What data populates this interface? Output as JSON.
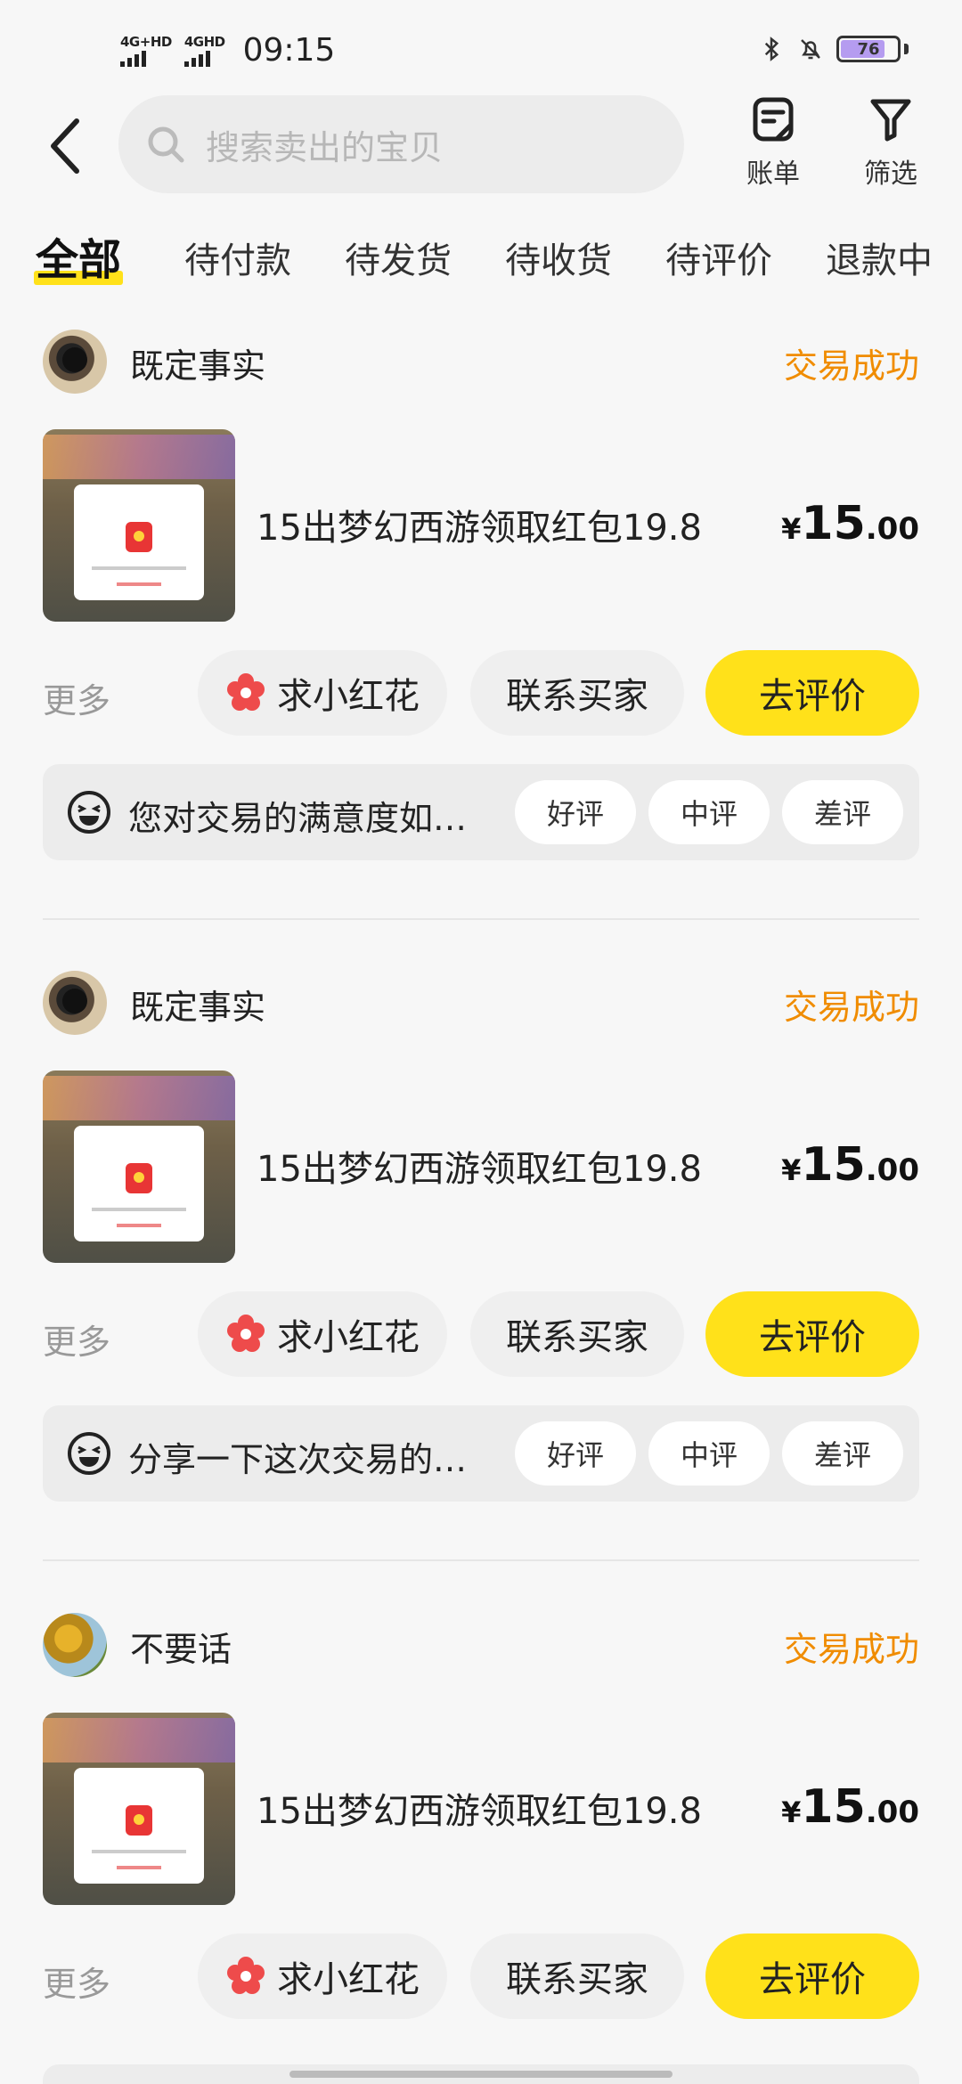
{
  "status_bar": {
    "sim1_label": "4G+HD",
    "sim2_label": "4GHD",
    "time": "09:15",
    "battery": "76",
    "battery_level": 0.76
  },
  "header": {
    "search_placeholder": "搜索卖出的宝贝",
    "bill_label": "账单",
    "filter_label": "筛选"
  },
  "tabs": [
    {
      "label": "全部",
      "active": true
    },
    {
      "label": "待付款"
    },
    {
      "label": "待发货"
    },
    {
      "label": "待收货"
    },
    {
      "label": "待评价"
    },
    {
      "label": "退款中"
    }
  ],
  "orders": [
    {
      "seller": "既定事实",
      "status": "交易成功",
      "title": "15出梦幻西游领取红包19.8",
      "price_symbol": "¥",
      "price_int": "15",
      "price_dec": ".00",
      "more": "更多",
      "flower_btn": "求小红花",
      "contact_btn": "联系买家",
      "review_btn": "去评价",
      "rating_prompt": "您对交易的满意度如…",
      "rating_good": "好评",
      "rating_mid": "中评",
      "rating_bad": "差评"
    },
    {
      "seller": "既定事实",
      "status": "交易成功",
      "title": "15出梦幻西游领取红包19.8",
      "price_symbol": "¥",
      "price_int": "15",
      "price_dec": ".00",
      "more": "更多",
      "flower_btn": "求小红花",
      "contact_btn": "联系买家",
      "review_btn": "去评价",
      "rating_prompt": "分享一下这次交易的…",
      "rating_good": "好评",
      "rating_mid": "中评",
      "rating_bad": "差评"
    },
    {
      "seller": "不要话",
      "status": "交易成功",
      "title": "15出梦幻西游领取红包19.8",
      "price_symbol": "¥",
      "price_int": "15",
      "price_dec": ".00",
      "more": "更多",
      "flower_btn": "求小红花",
      "contact_btn": "联系买家",
      "review_btn": "去评价"
    }
  ],
  "colors": {
    "accent_yellow": "#ffe11a",
    "status_orange": "#f08c00"
  }
}
